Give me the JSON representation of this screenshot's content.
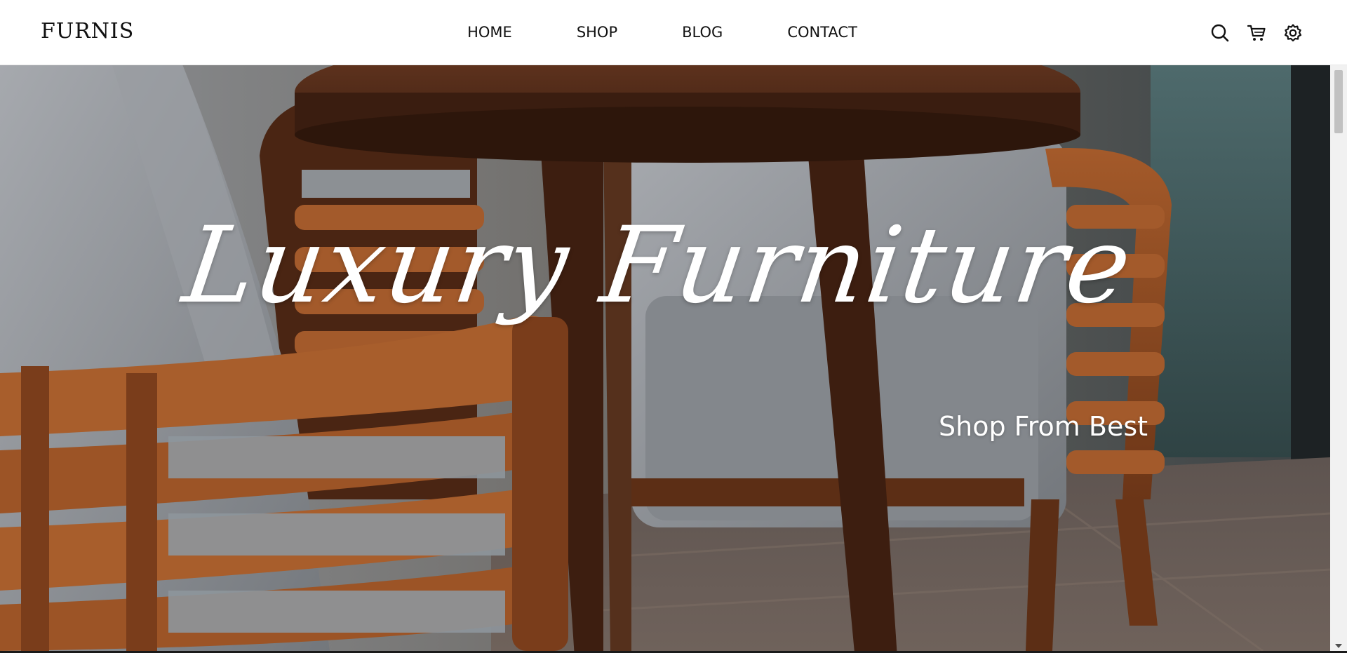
{
  "brand": {
    "logo_text": "FURNIS"
  },
  "nav": {
    "links": [
      {
        "label": "HOME"
      },
      {
        "label": "SHOP"
      },
      {
        "label": "BLOG"
      },
      {
        "label": "CONTACT"
      }
    ],
    "icons": [
      "search-icon",
      "cart-icon",
      "settings-icon"
    ]
  },
  "hero": {
    "title": "Luxury Furniture",
    "subtitle": "Shop From Best",
    "image_subject": "wooden armchairs with grey upholstery around a round wooden table"
  },
  "colors": {
    "nav_background": "#ffffff",
    "nav_text": "#111111",
    "hero_text": "#ffffff",
    "wood": "#7a3f1f",
    "upholstery": "#8a8d92"
  }
}
